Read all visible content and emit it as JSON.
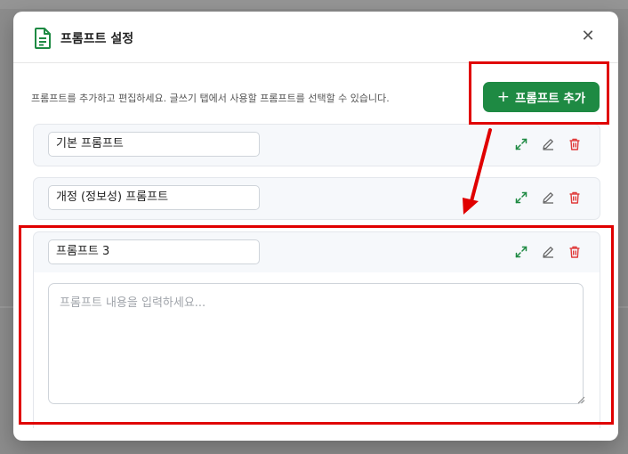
{
  "modal": {
    "title": "프롬프트 설정",
    "close_glyph": "✕",
    "description": "프롬프트를 추가하고 편집하세요. 글쓰기 탭에서 사용할 프롬프트를 선택할 수 있습니다.",
    "add_button": {
      "plus": "+",
      "label": "프롬프트 추가"
    },
    "prompts": [
      {
        "name": "기본 프롬프트"
      },
      {
        "name": "개정 (정보성) 프롬프트"
      },
      {
        "name": "프롬프트 3",
        "content_placeholder": "프롬프트 내용을 입력하세요..."
      }
    ],
    "card_icons": [
      "expand-icon",
      "pencil-icon",
      "trash-icon"
    ]
  },
  "colors": {
    "primary": "#1e8a43",
    "expand_icon": "#1e8a43",
    "edit_icon": "#666666",
    "delete_icon": "#e03a3a",
    "highlight": "#e00000"
  }
}
